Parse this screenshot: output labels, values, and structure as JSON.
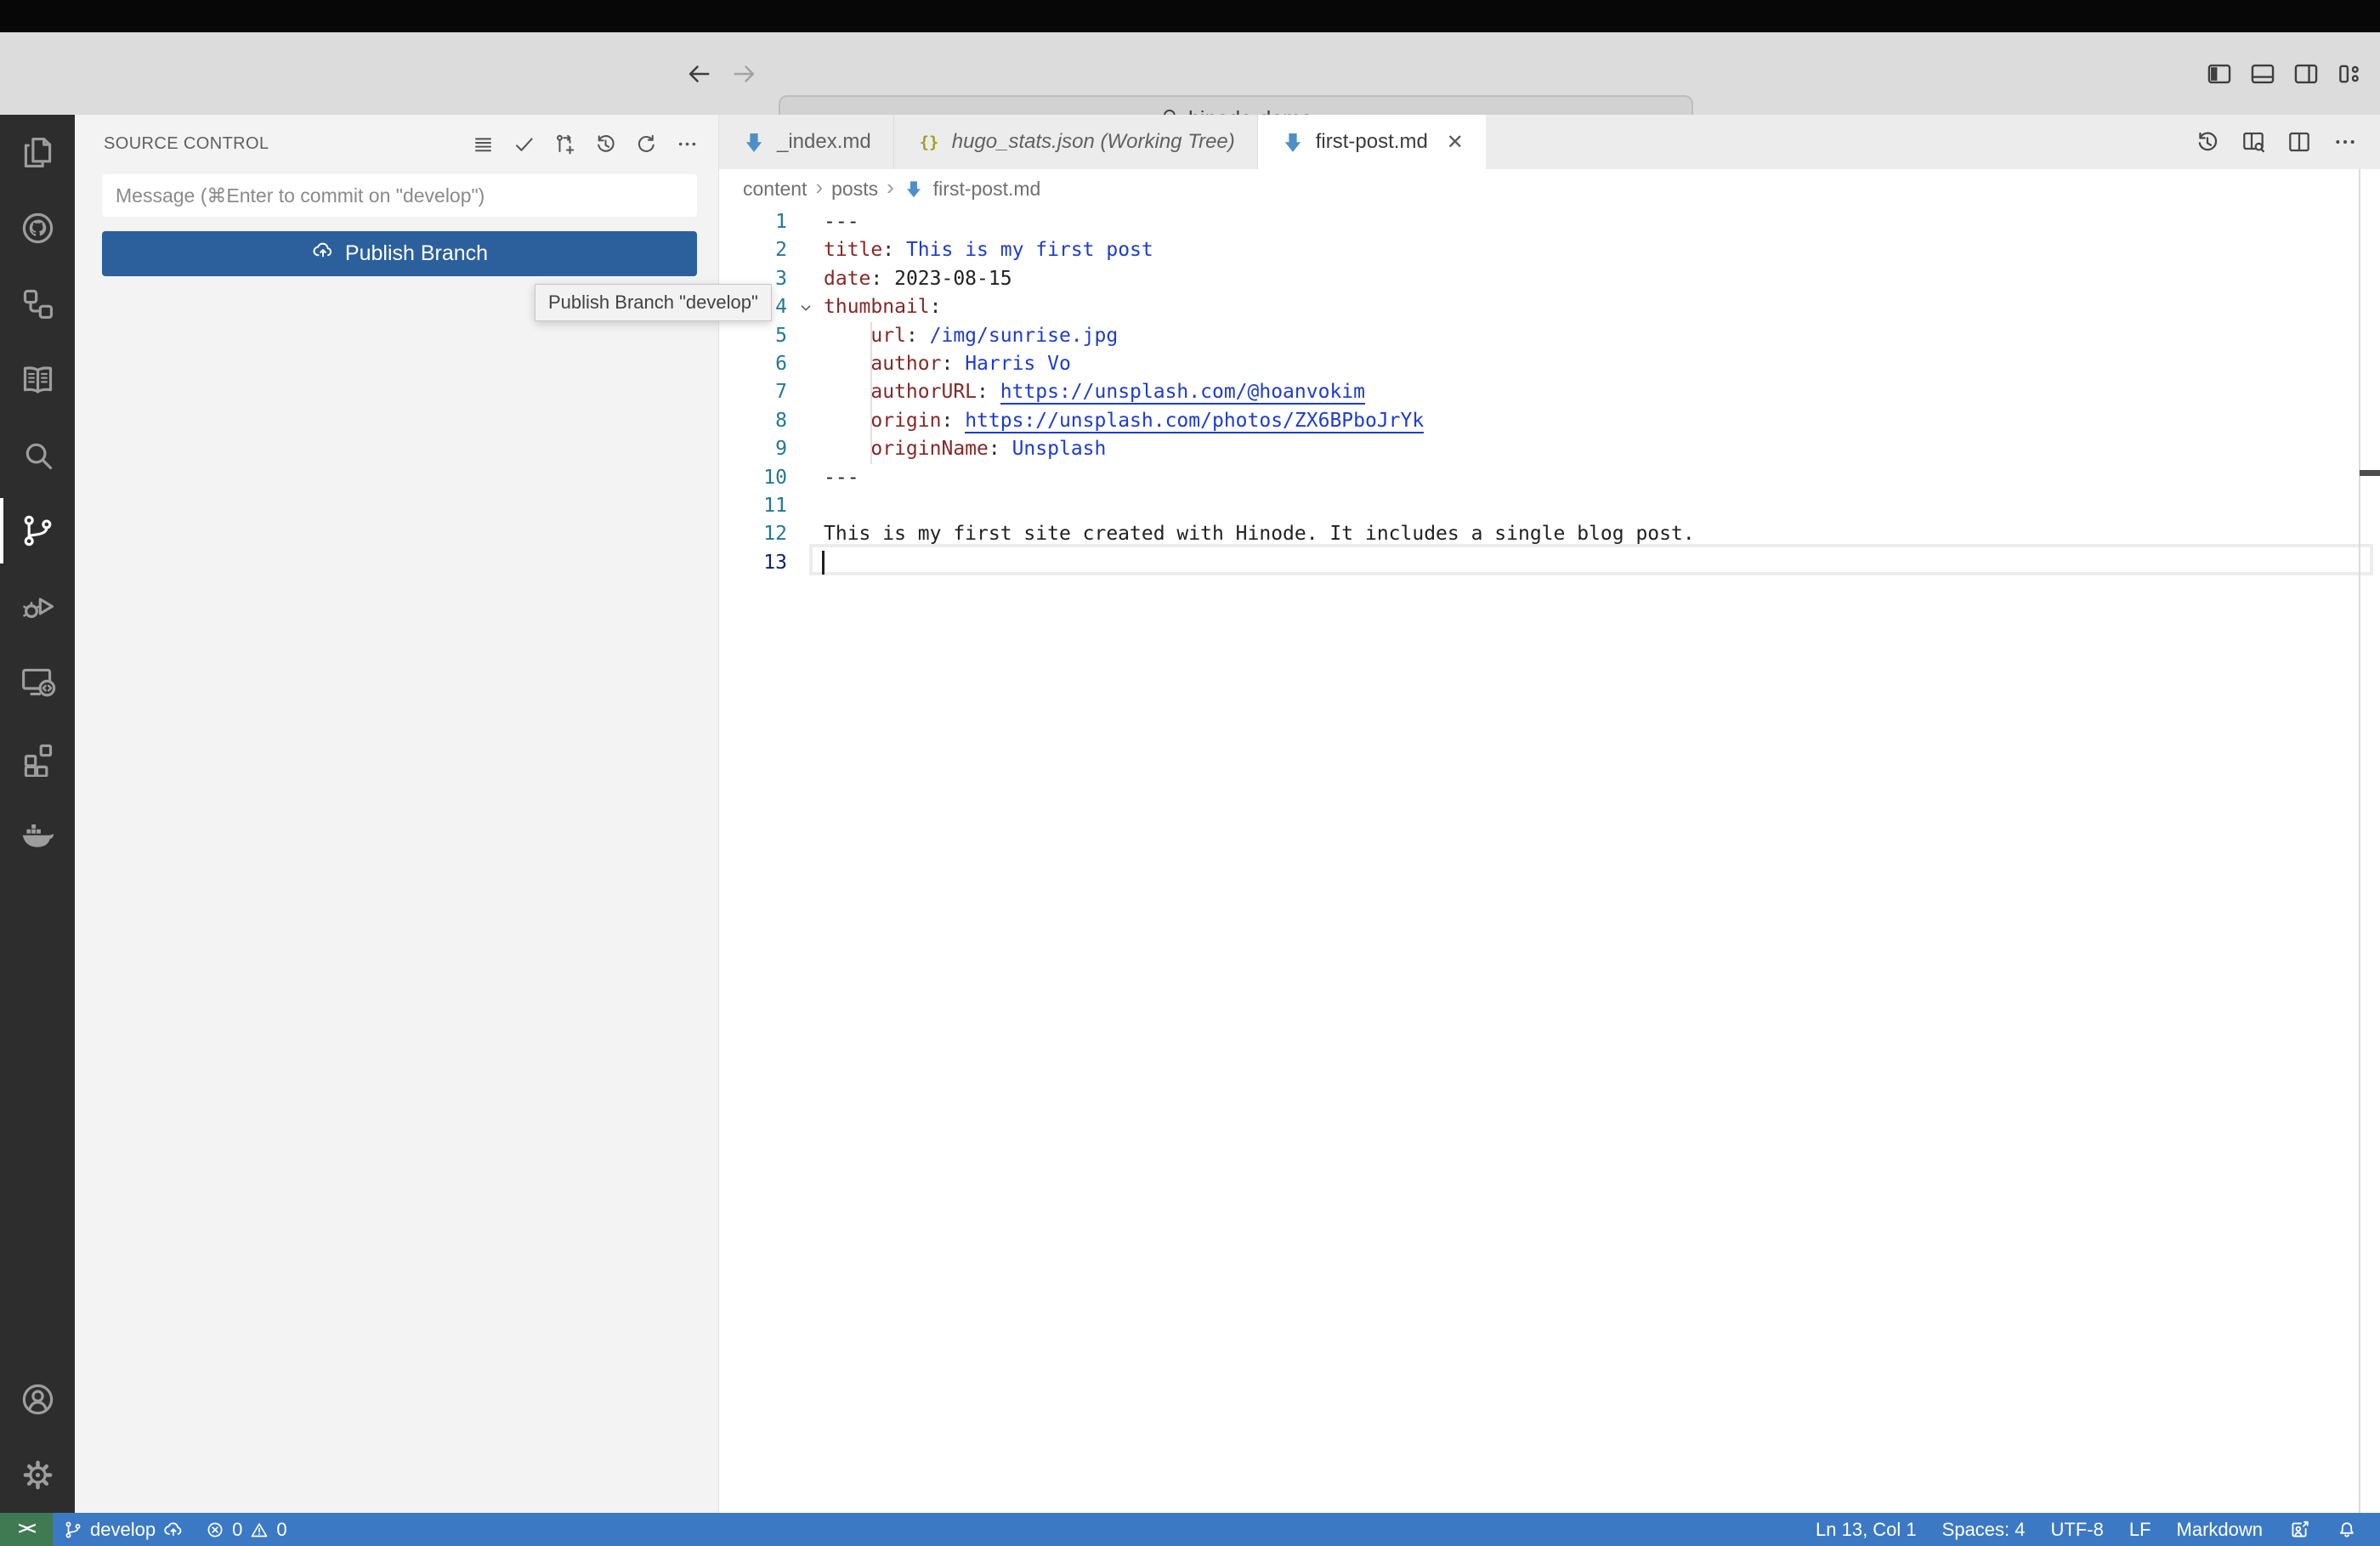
{
  "colors": {
    "status_blue": "#3b79c4",
    "status_green": "#3f7a52",
    "button_blue": "#2b609c",
    "markdown_icon_blue": "#4d8fc6",
    "json_icon_olive": "#a0a024",
    "yaml_key": "#872727",
    "yaml_value_blue": "#1d3bd2",
    "line_number": "#237893",
    "line_number_active": "#0b216f"
  },
  "titlebar": {
    "search_title": "hinode-demo",
    "nav_icons": [
      "arrow-left",
      "arrow-right"
    ],
    "layout_icons": [
      "layout-sidebar-left",
      "layout-panel",
      "layout-sidebar-right",
      "layout-customize"
    ]
  },
  "activity_bar": {
    "top": [
      "explorer",
      "github",
      "project-hierarchy",
      "docs-book",
      "search",
      "source-control",
      "run-debug",
      "remote-explorer",
      "extensions",
      "docker"
    ],
    "active": "source-control",
    "bottom": [
      "account",
      "settings-gear"
    ]
  },
  "scm": {
    "title": "SOURCE CONTROL",
    "toolbar": [
      "view-as-list",
      "commit-check",
      "create-pull-request",
      "history",
      "refresh",
      "more-actions"
    ],
    "message_placeholder": "Message (⌘Enter to commit on \"develop\")",
    "publish_button_label": "Publish Branch",
    "publish_button_icon": "cloud-upload",
    "tooltip": "Publish Branch \"develop\""
  },
  "editor": {
    "tabs": [
      {
        "label": "_index.md",
        "icon": "markdown",
        "italic": false,
        "active": false
      },
      {
        "label": "hugo_stats.json (Working Tree)",
        "icon": "json",
        "italic": true,
        "active": false
      },
      {
        "label": "first-post.md",
        "icon": "markdown",
        "italic": false,
        "active": true,
        "close_glyph": "✕"
      }
    ],
    "actions": [
      "timeline-history",
      "open-preview-side",
      "split-editor",
      "more-actions"
    ],
    "breadcrumb": [
      "content",
      "posts",
      "first-post.md"
    ],
    "breadcrumb_separator": "›",
    "breadcrumb_file_icon": "markdown",
    "lines": [
      {
        "n": 1,
        "tokens": [
          {
            "c": "plain",
            "t": "---"
          }
        ]
      },
      {
        "n": 2,
        "tokens": [
          {
            "c": "key",
            "t": "title"
          },
          {
            "c": "punct",
            "t": ": "
          },
          {
            "c": "str",
            "t": "This is my first post"
          }
        ]
      },
      {
        "n": 3,
        "tokens": [
          {
            "c": "key",
            "t": "date"
          },
          {
            "c": "punct",
            "t": ": "
          },
          {
            "c": "plain",
            "t": "2023-08-15"
          }
        ]
      },
      {
        "n": 4,
        "fold": true,
        "tokens": [
          {
            "c": "key",
            "t": "thumbnail"
          },
          {
            "c": "punct",
            "t": ":"
          }
        ]
      },
      {
        "n": 5,
        "tokens": [
          {
            "c": "plain",
            "t": "    "
          },
          {
            "c": "key",
            "t": "url"
          },
          {
            "c": "punct",
            "t": ": "
          },
          {
            "c": "str",
            "t": "/img/sunrise.jpg"
          }
        ]
      },
      {
        "n": 6,
        "tokens": [
          {
            "c": "plain",
            "t": "    "
          },
          {
            "c": "key",
            "t": "author"
          },
          {
            "c": "punct",
            "t": ": "
          },
          {
            "c": "str",
            "t": "Harris Vo"
          }
        ]
      },
      {
        "n": 7,
        "tokens": [
          {
            "c": "plain",
            "t": "    "
          },
          {
            "c": "key",
            "t": "authorURL"
          },
          {
            "c": "punct",
            "t": ": "
          },
          {
            "c": "link",
            "t": "https://unsplash.com/@hoanvokim"
          }
        ]
      },
      {
        "n": 8,
        "tokens": [
          {
            "c": "plain",
            "t": "    "
          },
          {
            "c": "key",
            "t": "origin"
          },
          {
            "c": "punct",
            "t": ": "
          },
          {
            "c": "link",
            "t": "https://unsplash.com/photos/ZX6BPboJrYk"
          }
        ]
      },
      {
        "n": 9,
        "tokens": [
          {
            "c": "plain",
            "t": "    "
          },
          {
            "c": "key",
            "t": "originName"
          },
          {
            "c": "punct",
            "t": ": "
          },
          {
            "c": "str",
            "t": "Unsplash"
          }
        ]
      },
      {
        "n": 10,
        "tokens": [
          {
            "c": "plain",
            "t": "---"
          }
        ]
      },
      {
        "n": 11,
        "tokens": []
      },
      {
        "n": 12,
        "tokens": [
          {
            "c": "plain",
            "t": "This is my first site created with Hinode. It includes a single blog post."
          }
        ]
      },
      {
        "n": 13,
        "current": true,
        "cursor": true,
        "tokens": []
      }
    ]
  },
  "status_bar": {
    "remote_glyph": "><",
    "branch": "develop",
    "branch_icon": "git-branch",
    "push_icon": "cloud-upload",
    "errors": "0",
    "warnings": "0",
    "error_icon": "error-circle",
    "warning_icon": "warning-triangle",
    "right_items": [
      {
        "name": "cursor-position",
        "label": "Ln 13, Col 1"
      },
      {
        "name": "indentation",
        "label": "Spaces: 4"
      },
      {
        "name": "encoding",
        "label": "UTF-8"
      },
      {
        "name": "eol",
        "label": "LF"
      },
      {
        "name": "language-mode",
        "label": "Markdown"
      }
    ],
    "right_icons": [
      "feedback",
      "bell"
    ]
  }
}
